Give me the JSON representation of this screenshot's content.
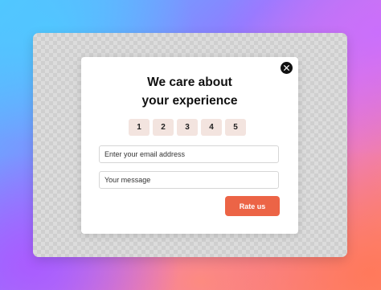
{
  "dialog": {
    "title_line1": "We care about",
    "title_line2": "your experience",
    "ratings": [
      "1",
      "2",
      "3",
      "4",
      "5"
    ],
    "email_placeholder": "Enter your email address",
    "message_placeholder": "Your message",
    "submit_label": "Rate us",
    "close_icon": "close-icon"
  },
  "colors": {
    "submit_button": "#ec6446",
    "rating_button": "#f3e4df",
    "close_button": "#111111"
  }
}
